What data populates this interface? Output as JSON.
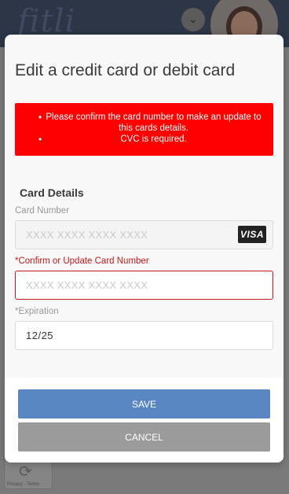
{
  "background": {
    "logo_text": "fitli",
    "badge_text": "Privacy - Terms"
  },
  "modal": {
    "title": "Edit a credit card or debit card",
    "errors": [
      "Please confirm the card number to make an update to this cards details.",
      "CVC is required."
    ],
    "section_title": "Card Details",
    "card_number": {
      "label": "Card Number",
      "placeholder": "XXXX XXXX XXXX XXXX",
      "brand": "VISA"
    },
    "confirm_card_number": {
      "label": "*Confirm or Update Card Number",
      "placeholder": "XXXX XXXX XXXX XXXX"
    },
    "expiration": {
      "label": "*Expiration",
      "value": "12/25"
    },
    "save_label": "SAVE",
    "cancel_label": "CANCEL"
  },
  "colors": {
    "error": "#ff0000",
    "required_label": "#c21a1a",
    "save_button": "#5b86c4",
    "cancel_button": "#9b9b9b"
  }
}
